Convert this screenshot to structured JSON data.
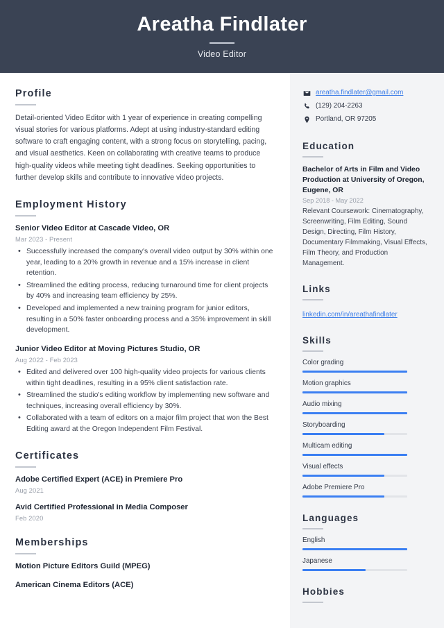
{
  "header": {
    "name": "Areatha Findlater",
    "job_title": "Video Editor"
  },
  "main": {
    "profile": {
      "heading": "Profile",
      "text": "Detail-oriented Video Editor with 1 year of experience in creating compelling visual stories for various platforms. Adept at using industry-standard editing software to craft engaging content, with a strong focus on storytelling, pacing, and visual aesthetics. Keen on collaborating with creative teams to produce high-quality videos while meeting tight deadlines. Seeking opportunities to further develop skills and contribute to innovative video projects."
    },
    "employment": {
      "heading": "Employment History",
      "jobs": [
        {
          "title": "Senior Video Editor at Cascade Video, OR",
          "date": "Mar 2023 - Present",
          "bullets": [
            "Successfully increased the company's overall video output by 30% within one year, leading to a 20% growth in revenue and a 15% increase in client retention.",
            "Streamlined the editing process, reducing turnaround time for client projects by 40% and increasing team efficiency by 25%.",
            "Developed and implemented a new training program for junior editors, resulting in a 50% faster onboarding process and a 35% improvement in skill development."
          ]
        },
        {
          "title": "Junior Video Editor at Moving Pictures Studio, OR",
          "date": "Aug 2022 - Feb 2023",
          "bullets": [
            "Edited and delivered over 100 high-quality video projects for various clients within tight deadlines, resulting in a 95% client satisfaction rate.",
            "Streamlined the studio's editing workflow by implementing new software and techniques, increasing overall efficiency by 30%.",
            "Collaborated with a team of editors on a major film project that won the Best Editing award at the Oregon Independent Film Festival."
          ]
        }
      ]
    },
    "certificates": {
      "heading": "Certificates",
      "items": [
        {
          "title": "Adobe Certified Expert (ACE) in Premiere Pro",
          "date": "Aug 2021"
        },
        {
          "title": "Avid Certified Professional in Media Composer",
          "date": "Feb 2020"
        }
      ]
    },
    "memberships": {
      "heading": "Memberships",
      "items": [
        {
          "title": "Motion Picture Editors Guild (MPEG)"
        },
        {
          "title": "American Cinema Editors (ACE)"
        }
      ]
    }
  },
  "aside": {
    "contact": [
      {
        "icon": "envelope-icon",
        "text": "areatha.findlater@gmail.com",
        "is_link": true
      },
      {
        "icon": "phone-icon",
        "text": "(129) 204-2263",
        "is_link": false
      },
      {
        "icon": "location-pin-icon",
        "text": "Portland, OR 97205",
        "is_link": false
      }
    ],
    "education": {
      "heading": "Education",
      "degree": "Bachelor of Arts in Film and Video Production at University of Oregon, Eugene, OR",
      "date": "Sep 2018 - May 2022",
      "coursework": "Relevant Coursework: Cinematography, Screenwriting, Film Editing, Sound Design, Directing, Film History, Documentary Filmmaking, Visual Effects, Film Theory, and Production Management."
    },
    "links": {
      "heading": "Links",
      "items": [
        {
          "label": "linkedin.com/in/areathafindlater"
        }
      ]
    },
    "skills": {
      "heading": "Skills",
      "items": [
        {
          "label": "Color grading",
          "level": 100
        },
        {
          "label": "Motion graphics",
          "level": 100
        },
        {
          "label": "Audio mixing",
          "level": 100
        },
        {
          "label": "Storyboarding",
          "level": 78
        },
        {
          "label": "Multicam editing",
          "level": 100
        },
        {
          "label": "Visual effects",
          "level": 78
        },
        {
          "label": "Adobe Premiere Pro",
          "level": 78
        }
      ]
    },
    "languages": {
      "heading": "Languages",
      "items": [
        {
          "label": "English",
          "level": 100
        },
        {
          "label": "Japanese",
          "level": 60
        }
      ]
    },
    "hobbies": {
      "heading": "Hobbies"
    }
  },
  "colors": {
    "header_bg": "#3a4354",
    "sidebar_bg": "#f3f4f6",
    "accent_blue": "#3b7ff2",
    "link_blue": "#3f7fe8",
    "text_dark": "#1f2633",
    "text_muted": "#9aa0ab"
  }
}
